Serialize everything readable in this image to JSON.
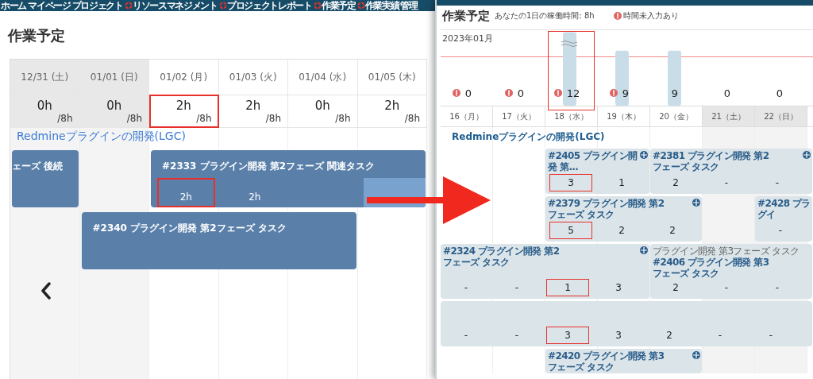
{
  "left_screen": {
    "nav": [
      {
        "label": "ホーム",
        "icon": false
      },
      {
        "label": "マイページ",
        "icon": false
      },
      {
        "label": "プロジェクト",
        "icon": false
      },
      {
        "label": "リソースマネジメント",
        "icon": true
      },
      {
        "label": "プロジェクトレポート",
        "icon": true
      },
      {
        "label": "作業予定",
        "icon": true
      },
      {
        "label": "作業実績",
        "icon": true
      },
      {
        "label": "管理",
        "icon": false
      }
    ],
    "title": "作業予定",
    "days": [
      {
        "label": "12/31 (土)",
        "weekend": true,
        "hours": "0h",
        "capacity": "/8h",
        "marked": false
      },
      {
        "label": "01/01 (日)",
        "weekend": true,
        "hours": "0h",
        "capacity": "/8h",
        "marked": false
      },
      {
        "label": "01/02 (月)",
        "weekend": false,
        "hours": "2h",
        "capacity": "/8h",
        "marked": true
      },
      {
        "label": "01/03 (火)",
        "weekend": false,
        "hours": "2h",
        "capacity": "/8h",
        "marked": false
      },
      {
        "label": "01/04 (水)",
        "weekend": false,
        "hours": "0h",
        "capacity": "/8h",
        "marked": false
      },
      {
        "label": "01/05 (木)",
        "weekend": false,
        "hours": "2h",
        "capacity": "/8h",
        "marked": false
      }
    ],
    "project": "Redmineプラグインの開発(LGC)",
    "lanes": [
      [
        {
          "kind": "task",
          "title": "ェーズ 後続",
          "cells": [
            {
              "highlight": false
            }
          ]
        },
        {
          "kind": "gap"
        },
        {
          "kind": "task",
          "title": "#2333 プラグイン開発 第2フェーズ 関連タスク",
          "cells": [
            {
              "text": "2h",
              "marked": true,
              "highlight": false
            },
            {
              "text": "2h",
              "marked": false,
              "highlight": false
            },
            {
              "highlight": false
            },
            {
              "highlight": true
            }
          ]
        }
      ],
      [
        {
          "kind": "gap"
        },
        {
          "kind": "task",
          "title": "#2340 プラグイン開発 第2フェーズ タスク",
          "cells": [
            {
              "highlight": false
            },
            {
              "highlight": false
            },
            {
              "highlight": false
            },
            {
              "highlight": false
            }
          ]
        }
      ]
    ]
  },
  "right_screen": {
    "title": "作業予定",
    "work_hours": "あなたの1日の稼働時間: 8h",
    "legend": "時間未入力あり",
    "month": "2023年01月",
    "chart_data": {
      "type": "bar",
      "categories": [
        "16（月）",
        "17（火）",
        "18（水）",
        "19（木）",
        "20（金）",
        "21（土）",
        "22（日）"
      ],
      "values": [
        0,
        0,
        12,
        9,
        9,
        0,
        0
      ],
      "data_labels": true
    },
    "missing_time": [
      true,
      true,
      true,
      true,
      false,
      false,
      false
    ],
    "marked": [
      false,
      false,
      true,
      false,
      false,
      false,
      false
    ],
    "weekend": [
      false,
      false,
      false,
      false,
      false,
      true,
      true
    ],
    "project": "Redmineプラグインの開発(LGC)",
    "lanes": [
      [
        {
          "kind": "gap"
        },
        {
          "kind": "gap"
        },
        {
          "kind": "task",
          "title": "#2405 プラグイン開発 第...",
          "icon": true,
          "cells": [
            {
              "text": "3",
              "marked": true
            },
            {
              "text": "1",
              "marked": false
            }
          ]
        },
        {
          "kind": "task",
          "title": "#2381 プラグイン開発 第2フェーズ タスク",
          "icon": true,
          "cells": [
            {
              "text": "2",
              "marked": false
            },
            {
              "text": "-",
              "marked": false
            },
            {
              "text": "-",
              "marked": false
            }
          ]
        }
      ],
      [
        {
          "kind": "gap"
        },
        {
          "kind": "gap"
        },
        {
          "kind": "task",
          "title": "#2379 プラグイン開発 第2フェーズ タスク",
          "icon": true,
          "cells": [
            {
              "text": "5",
              "marked": true
            },
            {
              "text": "2",
              "marked": false
            },
            {
              "text": "2",
              "marked": false
            }
          ]
        },
        {
          "kind": "gap"
        },
        {
          "kind": "task",
          "title": "#2428 プラグイ",
          "icon": false,
          "cells": [
            {
              "text": "-",
              "marked": false
            }
          ]
        }
      ],
      [
        {
          "kind": "task",
          "title": "#2324 プラグイン開発 第2フェーズ タスク",
          "icon": true,
          "cells": [
            {
              "text": "-",
              "marked": false
            },
            {
              "text": "-",
              "marked": false
            },
            {
              "text": "1",
              "marked": true
            },
            {
              "text": "3",
              "marked": false
            }
          ]
        },
        {
          "kind": "task",
          "subtitle": "プラグイン開発 第3フェーズ タスク",
          "title": "#2406 プラグイン開発 第3フェーズ タスク",
          "icon": false,
          "cells": [
            {
              "text": "2",
              "marked": false
            },
            {
              "text": "-",
              "marked": false
            },
            {
              "text": "-",
              "marked": false
            }
          ]
        }
      ],
      [
        {
          "kind": "task",
          "icon": false,
          "cells": [
            {
              "text": "-",
              "marked": false
            },
            {
              "text": "-",
              "marked": false
            },
            {
              "text": "3",
              "marked": true
            },
            {
              "text": "3",
              "marked": false
            },
            {
              "text": "2",
              "marked": false
            },
            {
              "text": "-",
              "marked": false
            },
            {
              "text": "-",
              "marked": false
            }
          ]
        }
      ],
      [
        {
          "kind": "gap"
        },
        {
          "kind": "gap"
        },
        {
          "kind": "task",
          "title": "#2420 プラグイン開発 第3フェーズ タスク",
          "icon": true
        }
      ]
    ]
  }
}
